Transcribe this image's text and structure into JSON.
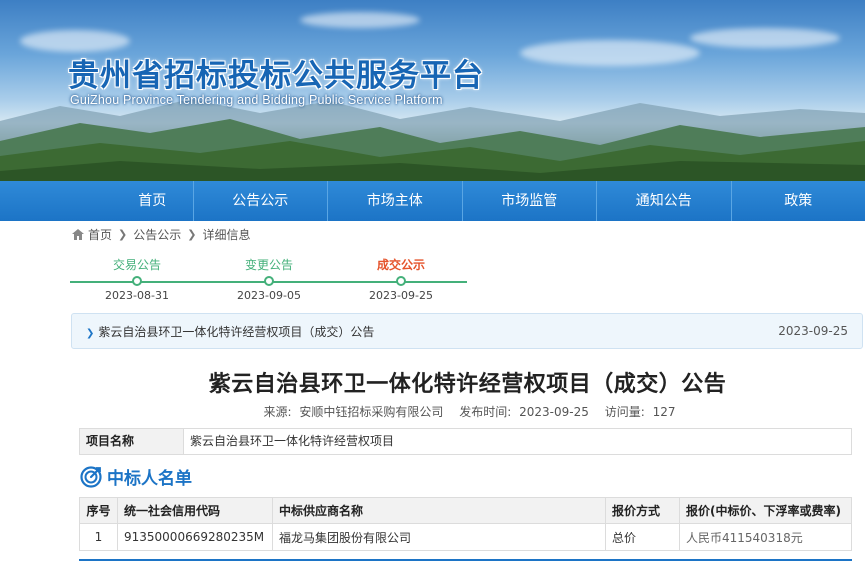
{
  "site": {
    "title": "贵州省招标投标公共服务平台",
    "subtitle": "GuiZhou Province Tendering and Bidding Public Service Platform"
  },
  "nav": [
    "首页",
    "公告公示",
    "市场主体",
    "市场监管",
    "通知公告",
    "政策"
  ],
  "breadcrumb": [
    "首页",
    "公告公示",
    "详细信息"
  ],
  "timeline": [
    {
      "label": "交易公告",
      "date": "2023-08-31",
      "active": false
    },
    {
      "label": "变更公告",
      "date": "2023-09-05",
      "active": false
    },
    {
      "label": "成交公示",
      "date": "2023-09-25",
      "active": true
    }
  ],
  "notice": {
    "text": "紫云自治县环卫一体化特许经营权项目（成交）公告",
    "date": "2023-09-25"
  },
  "doc": {
    "title": "紫云自治县环卫一体化特许经营权项目（成交）公告",
    "source_label": "来源:",
    "source": "安顺中钰招标采购有限公司",
    "publish_label": "发布时间:",
    "publish_time": "2023-09-25",
    "views_label": "访问量:",
    "views": "127"
  },
  "project": {
    "label": "项目名称",
    "value": "紫云自治县环卫一体化特许经营权项目"
  },
  "winners": {
    "section_title": "中标人名单",
    "headers": [
      "序号",
      "统一社会信用代码",
      "中标供应商名称",
      "报价方式",
      "报价(中标价、下浮率或费率)"
    ],
    "rows": [
      [
        "1",
        "91350000669280235M",
        "福龙马集团股份有限公司",
        "总价",
        "人民币411540318元"
      ]
    ]
  },
  "colors": {
    "primary": "#1c74c6",
    "timeline_green": "#44b07a",
    "active_step": "#e5532b"
  }
}
